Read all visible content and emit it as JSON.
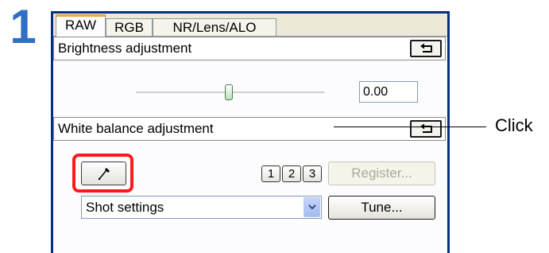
{
  "step_number": "1",
  "tabs": [
    {
      "label": "RAW",
      "active": true
    },
    {
      "label": "RGB",
      "active": false
    },
    {
      "label": "NR/Lens/ALO",
      "active": false
    }
  ],
  "brightness": {
    "label": "Brightness adjustment",
    "value": "0.00",
    "slider_level_percent": 50
  },
  "white_balance": {
    "label": "White balance adjustment",
    "number_buttons": [
      "1",
      "2",
      "3"
    ],
    "register_label": "Register...",
    "dropdown_value": "Shot settings",
    "tune_label": "Tune..."
  },
  "callout": {
    "text": "Click"
  },
  "colors": {
    "step_number": "#2f6fc4",
    "window_frame": "#0a2d84",
    "highlight": "#ff1a1a",
    "active_tab_accent": "#f0a23c"
  },
  "icons": {
    "reset": "reset-arrow-icon",
    "eyedropper": "eyedropper-icon",
    "dropdown": "chevron-down-icon"
  }
}
